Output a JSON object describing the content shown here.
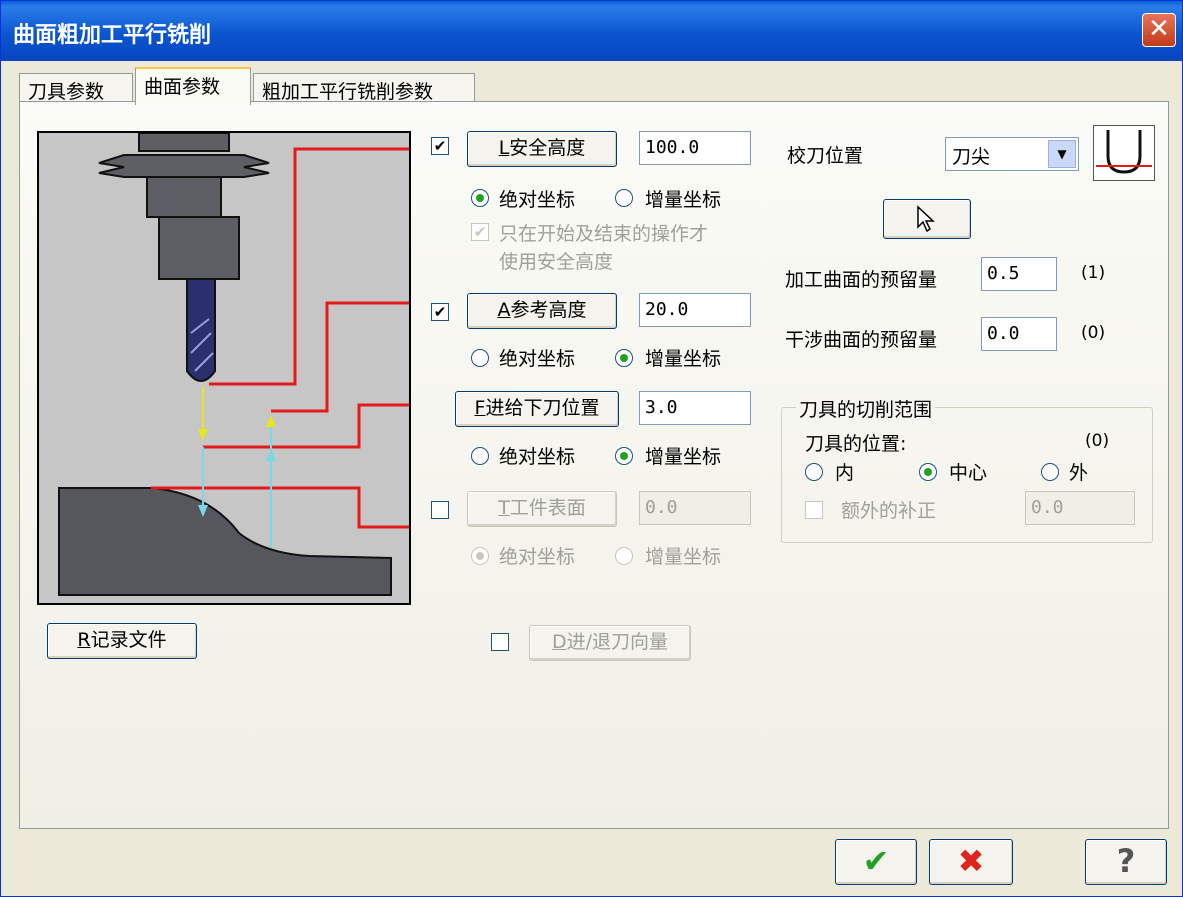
{
  "window": {
    "title": "曲面粗加工平行铣削",
    "close_glyph": "✕"
  },
  "tabs": [
    {
      "label": "刀具参数"
    },
    {
      "label": "曲面参数",
      "active": true
    },
    {
      "label": "粗加工平行铣削参数"
    }
  ],
  "clearance": {
    "mnemonic": "L",
    "label": "安全高度",
    "value": "100.0",
    "checked": "✔",
    "abs_label": "绝对坐标",
    "inc_label": "增量坐标",
    "only_start_end_line1": "只在开始及结束的操作才",
    "only_start_end_line2": "使用安全高度"
  },
  "retract": {
    "mnemonic": "A",
    "label": "参考高度",
    "value": "20.0",
    "checked": "✔",
    "abs_label": "绝对坐标",
    "inc_label": "增量坐标"
  },
  "feed_plane": {
    "mnemonic": "F",
    "label": "进给下刀位置",
    "value": "3.0",
    "abs_label": "绝对坐标",
    "inc_label": "增量坐标"
  },
  "top_of_stock": {
    "mnemonic": "T",
    "label": "工件表面",
    "value": "0.0",
    "abs_label": "绝对坐标",
    "inc_label": "增量坐标"
  },
  "record_button": {
    "mnemonic": "R",
    "label": "记录文件"
  },
  "entry_exit": {
    "mnemonic": "D",
    "label": "进/退刀向量"
  },
  "tip_comp": {
    "label": "校刀位置",
    "selected": "刀尖",
    "arrow": "▼"
  },
  "stock_drive": {
    "label": "加工曲面的预留量",
    "value": "0.5",
    "count": "(1)"
  },
  "stock_check": {
    "label": "干涉曲面的预留量",
    "value": "0.0",
    "count": "(0)"
  },
  "containment": {
    "title": "刀具的切削范围",
    "position_label": "刀具的位置:",
    "count": "(0)",
    "inside": "内",
    "center": "中心",
    "outside": "外",
    "extra_comp": "额外的补正",
    "extra_value": "0.0"
  },
  "footer": {
    "ok": "✔",
    "cancel": "✖",
    "help": "?"
  },
  "colors": {
    "title_bar": "#0b55d0",
    "ok": "#22a122",
    "cancel": "#e0231b",
    "illustration_red": "#e3191b",
    "tool_blue": "#2a2f6e"
  },
  "icons": {
    "pointer": "pointer-icon",
    "tool_tip": "tool-tip-icon"
  }
}
